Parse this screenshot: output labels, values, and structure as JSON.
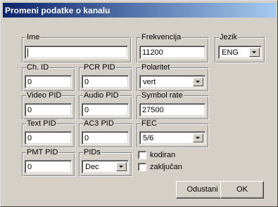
{
  "window": {
    "title": "Promeni podatke o kanalu"
  },
  "fields": {
    "ime": {
      "label": "Ime",
      "value": ""
    },
    "frekvencija": {
      "label": "Frekvencija",
      "value": "11200"
    },
    "jezik": {
      "label": "Jezik",
      "value": "ENG"
    },
    "ch_id": {
      "label": "Ch. ID",
      "value": "0"
    },
    "pcr_pid": {
      "label": "PCR PID",
      "value": "0"
    },
    "polaritet": {
      "label": "Polaritet",
      "value": "vert"
    },
    "video_pid": {
      "label": "Video PID",
      "value": "0"
    },
    "audio_pid": {
      "label": "Audio PID",
      "value": "0"
    },
    "symbol_rate": {
      "label": "Symbol rate",
      "value": "27500"
    },
    "text_pid": {
      "label": "Text PID",
      "value": "0"
    },
    "ac3_pid": {
      "label": "AC3 PID",
      "value": "0"
    },
    "fec": {
      "label": "FEC",
      "value": "5/6"
    },
    "pmt_pid": {
      "label": "PMT PID",
      "value": "0"
    },
    "pids": {
      "label": "PIDs",
      "value": "Dec"
    }
  },
  "checkboxes": {
    "kodiran": {
      "label": "kodiran",
      "checked": false
    },
    "zakljucan": {
      "label": "zaključan",
      "checked": false
    }
  },
  "buttons": {
    "cancel": "Odustani",
    "ok": "OK"
  },
  "colors": {
    "face": "#d4d0c8",
    "title_start": "#0a246a",
    "title_end": "#a6caf0"
  }
}
